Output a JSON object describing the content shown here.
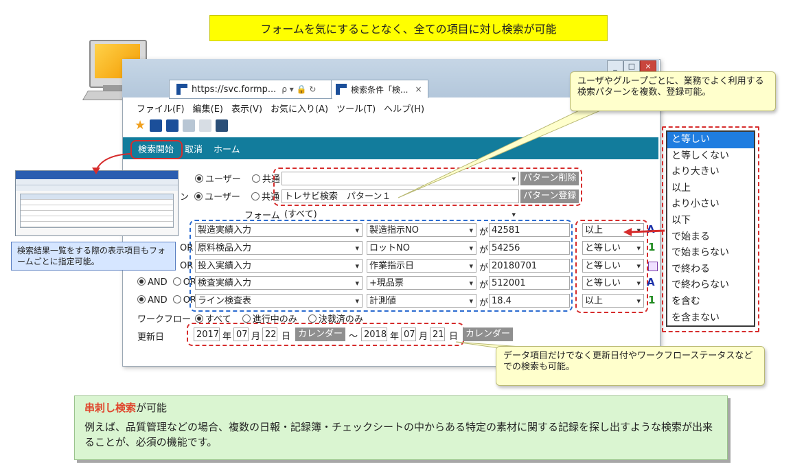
{
  "headline": "フォームを気にすることなく、全ての項目に対し検索が可能",
  "browser": {
    "address": "https://svc.formp...",
    "address_icons": "ρ ▾ 🔒 ↻",
    "tab_title": "検索条件「検...",
    "tab_close": "×",
    "menu": [
      "ファイル(F)",
      "編集(E)",
      "表示(V)",
      "お気に入り(A)",
      "ツール(T)",
      "ヘルプ(H)"
    ],
    "window_buttons": [
      "_",
      "□",
      "×"
    ]
  },
  "appbar": {
    "search_start": "検索開始",
    "cancel": "取消",
    "home": "ホーム"
  },
  "form": {
    "scope_row1": {
      "user": "ユーザー",
      "shared": "共通",
      "pattern_value": "",
      "button": "パターン削除"
    },
    "scope_row2": {
      "prefix": "ン",
      "user": "ユーザー",
      "shared": "共通",
      "pattern_value": "トレサビ検索　パターン１",
      "button": "パターン登録"
    },
    "form_label": "フォーム",
    "form_value": "(すべて)",
    "conditions": [
      {
        "logic": "",
        "form": "製造実績入力",
        "field": "製造指示NO",
        "ga": "が",
        "value": "42581",
        "op": "以上",
        "type_icon": "A"
      },
      {
        "logic": "OR",
        "form": "原料検品入力",
        "field": "ロットNO",
        "ga": "が",
        "value": "54256",
        "op": "と等しい",
        "type_icon": "1"
      },
      {
        "logic": "OR",
        "form": "投入実績入力",
        "field": "作業指示日",
        "ga": "が",
        "value": "20180701",
        "op": "と等しい",
        "type_icon": "cal"
      },
      {
        "logic": "AND OR",
        "form": "検査実績入力",
        "field": "+現品票",
        "ga": "が",
        "value": "512001",
        "op": "と等しい",
        "type_icon": "A"
      },
      {
        "logic": "AND OR",
        "form": "ライン検査表",
        "field": "計測値",
        "ga": "が",
        "value": "18.4",
        "op": "以上",
        "type_icon": "1"
      }
    ],
    "and_label": "AND",
    "or_label": "OR",
    "workflow_label": "ワークフロー",
    "workflow_options": [
      "すべて",
      "進行中のみ",
      "決裁済のみ"
    ],
    "updated_label": "更新日",
    "date_from": {
      "year": "2017",
      "month": "07",
      "day": "22"
    },
    "date_to": {
      "year": "2018",
      "month": "07",
      "day": "21"
    },
    "year_unit": "年",
    "month_unit": "月",
    "day_unit": "日",
    "calendar_button": "カレンダー",
    "tilde": "～"
  },
  "operator_list": [
    "と等しい",
    "と等しくない",
    "より大きい",
    "以上",
    "より小さい",
    "以下",
    "で始まる",
    "で始まらない",
    "で終わる",
    "で終わらない",
    "を含む",
    "を含まない"
  ],
  "callouts": {
    "pattern": "ユーザやグループごとに、業務でよく利用する検索パターンを複数、登録可能。",
    "date": "データ項目だけでなく更新日付やワークフローステータスなどでの検索も可能。",
    "columns": "検索結果一覧をする際の表示項目もフォームごとに指定可能。"
  },
  "bottom": {
    "title_em": "串刺し検索",
    "title_rest": "が可能",
    "body": "例えば、品質管理などの場合、複数の日報・記録簿・チェックシートの中からある特定の素材に関する記録を探し出すような検索が出来ることが、必須の機能です。"
  },
  "colors": {
    "appbar": "#127c9c",
    "highlight": "#ffff00",
    "callout": "#ffffcc",
    "green": "#daf5d1",
    "dash_red": "#d62c2c",
    "dash_blue": "#2a6bd0"
  }
}
